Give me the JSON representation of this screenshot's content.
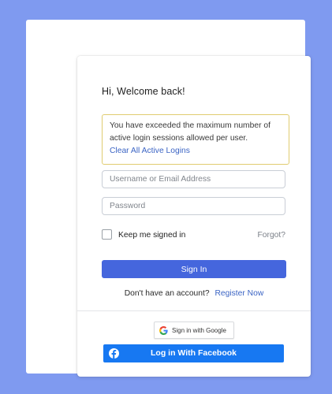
{
  "login": {
    "greeting": "Hi, Welcome back!",
    "notice": {
      "message": "You have exceeded the maximum number of active login sessions allowed per user.",
      "link": "Clear All Active Logins"
    },
    "username_placeholder": "Username or Email Address",
    "password_placeholder": "Password",
    "remember_label": "Keep me signed in",
    "remember_checked": false,
    "forgot_label": "Forgot?",
    "signin_label": "Sign In",
    "register_prompt": "Don't have an account?",
    "register_link": "Register Now",
    "google_label": "Sign in with Google",
    "facebook_label": "Log in With Facebook"
  },
  "colors": {
    "background": "#7f9af0",
    "primary_button": "#4566dd",
    "link": "#3b64c4",
    "notice_border": "#e0cc70",
    "facebook": "#1778f2"
  },
  "icons": {
    "google": "google-g-icon",
    "facebook": "facebook-f-icon"
  }
}
